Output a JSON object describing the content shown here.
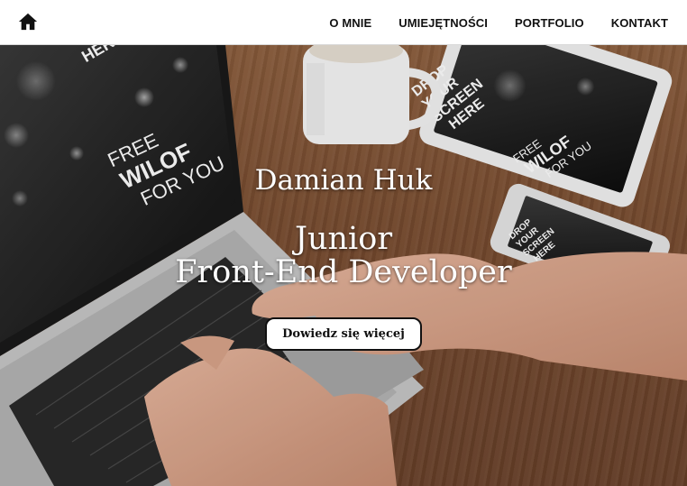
{
  "nav": {
    "home_icon": "home-icon",
    "items": [
      {
        "label": "O MNIE"
      },
      {
        "label": "UMIEJĘTNOŚCI"
      },
      {
        "label": "PORTFOLIO"
      },
      {
        "label": "KONTAKT"
      }
    ]
  },
  "hero": {
    "name": "Damian Huk",
    "role_line1": "Junior",
    "role_line2": "Front-End Developer",
    "cta_label": "Dowiedz się więcej",
    "laptop_screen_text": [
      "FREE",
      "WILOF",
      "FOR YOU"
    ],
    "laptop_screen_top_text": "HERE",
    "tablet_screen_text": [
      "DROP",
      "YOUR",
      "SCREEN",
      "HERE",
      "FREE",
      "WILOF",
      "FOR YOU"
    ],
    "phone_screen_text": [
      "DROP",
      "YOUR",
      "SCREEN",
      "HERE"
    ]
  }
}
